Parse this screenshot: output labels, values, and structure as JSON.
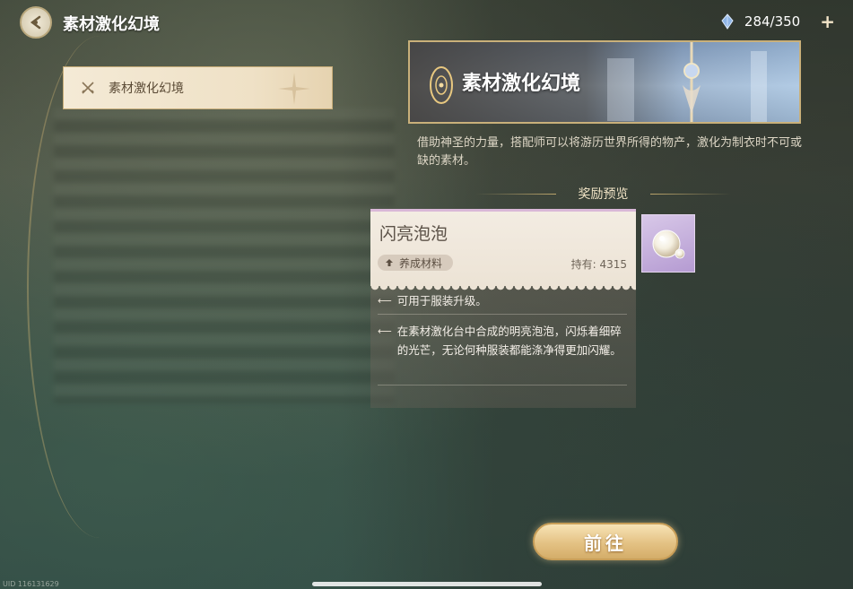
{
  "header": {
    "title": "素材激化幻境",
    "stamina": "284/350"
  },
  "sidebar": {
    "items": [
      {
        "label": "素材激化幻境"
      }
    ]
  },
  "banner": {
    "name": "素材激化幻境",
    "description": "借助神圣的力量，搭配师可以将游历世界所得的物产，激化为制衣时不可或缺的素材。"
  },
  "reward": {
    "title": "奖励预览",
    "item": {
      "name": "闪亮泡泡",
      "tag": "养成材料",
      "owned": "持有: 4315",
      "effect1": "可用于服装升级。",
      "effect2": "在素材激化台中合成的明亮泡泡，闪烁着细碎的光芒，无论何种服装都能涤净得更加闪耀。"
    }
  },
  "actions": {
    "go_label": "前往"
  },
  "footer": {
    "uid": "UID 116131629"
  }
}
